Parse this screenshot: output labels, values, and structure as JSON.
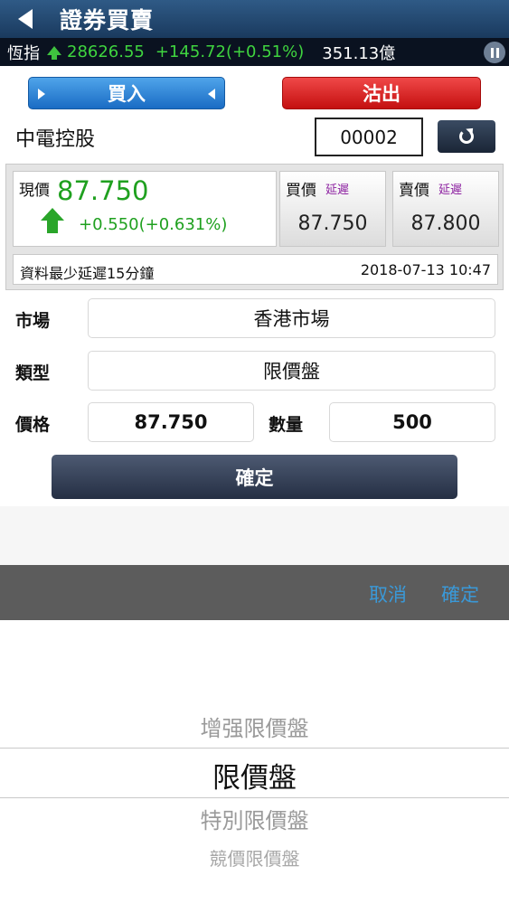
{
  "header": {
    "title": "證券買賣"
  },
  "ticker": {
    "index_name": "恆指",
    "value": "28626.55",
    "change": "+145.72(+0.51%)",
    "turnover": "351.13億"
  },
  "trade_tabs": {
    "buy_label": "買入",
    "sell_label": "沽出"
  },
  "stock": {
    "name": "中電控股",
    "code": "00002"
  },
  "quote": {
    "current_label": "現價",
    "current_price": "87.750",
    "change": "+0.550(+0.631%)",
    "bid_label": "買價",
    "bid_delay": "延遲",
    "bid_value": "87.750",
    "ask_label": "賣價",
    "ask_delay": "延遲",
    "ask_value": "87.800",
    "delay_note": "資料最少延遲15分鐘",
    "timestamp": "2018-07-13 10:47"
  },
  "form": {
    "market_label": "市場",
    "market_value": "香港市場",
    "type_label": "類型",
    "type_value": "限價盤",
    "price_label": "價格",
    "price_value": "87.750",
    "qty_label": "數量",
    "qty_value": "500",
    "confirm_label": "確定"
  },
  "picker": {
    "cancel_label": "取消",
    "done_label": "確定",
    "options": [
      "增强限價盤",
      "限價盤",
      "特別限價盤",
      "競價限價盤"
    ],
    "selected": "限價盤"
  },
  "colors": {
    "up_green": "#1fa01f",
    "buy_blue": "#1a6cc4",
    "sell_red": "#c41010",
    "picker_link": "#3a99d8"
  }
}
